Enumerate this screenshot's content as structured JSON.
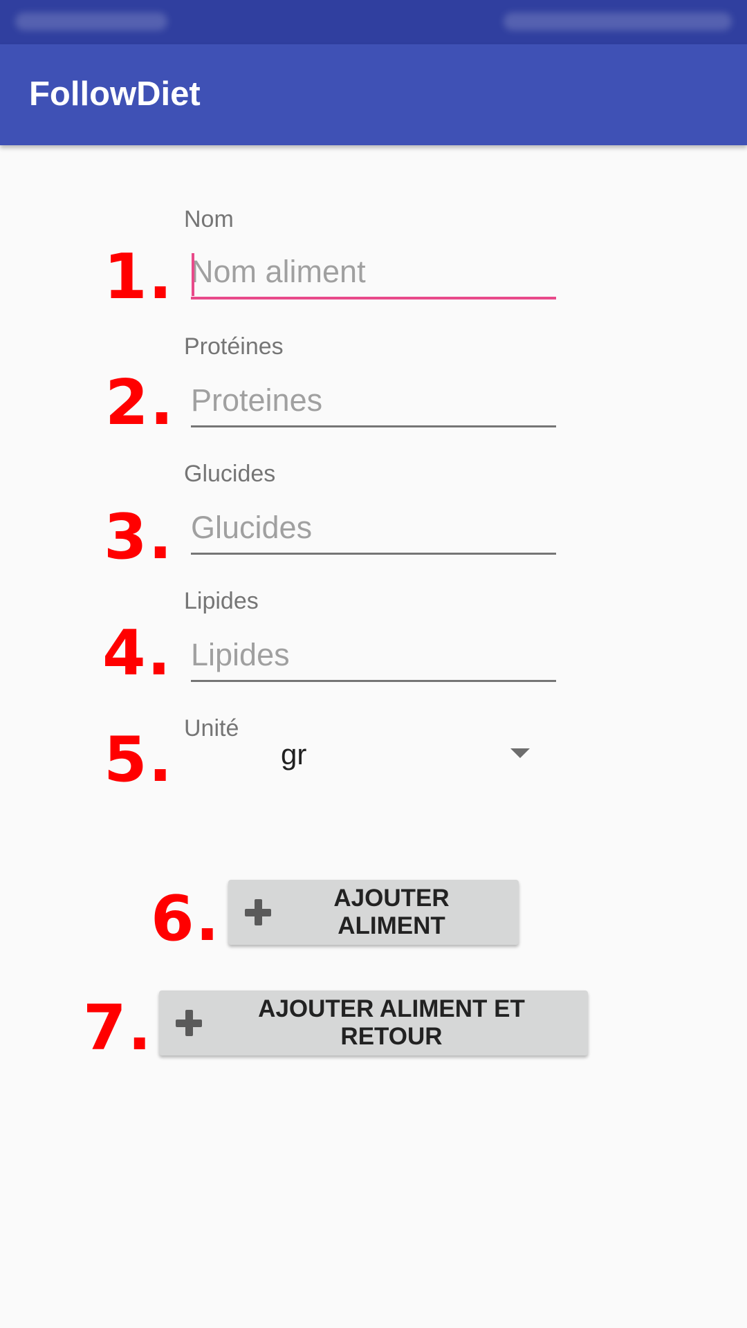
{
  "app": {
    "title": "FollowDiet"
  },
  "colors": {
    "status_bar": "#303f9f",
    "app_bar": "#3f51b5",
    "accent": "#e84a8a",
    "annotation": "#ff0000",
    "button_bg": "#d6d7d7"
  },
  "form": {
    "fields": [
      {
        "label": "Nom",
        "placeholder": "Nom aliment",
        "value": "",
        "focused": true
      },
      {
        "label": "Protéines",
        "placeholder": "Proteines",
        "value": ""
      },
      {
        "label": "Glucides",
        "placeholder": "Glucides",
        "value": ""
      },
      {
        "label": "Lipides",
        "placeholder": "Lipides",
        "value": ""
      }
    ],
    "unit": {
      "label": "Unité",
      "selected": "gr",
      "icon": "dropdown-arrow-icon"
    }
  },
  "buttons": {
    "add": {
      "label": "AJOUTER ALIMENT",
      "icon": "plus-icon"
    },
    "add_and_back": {
      "label": "AJOUTER ALIMENT ET RETOUR",
      "icon": "plus-icon"
    }
  },
  "annotations": [
    "1.",
    "2.",
    "3.",
    "4.",
    "5.",
    "6.",
    "7."
  ]
}
